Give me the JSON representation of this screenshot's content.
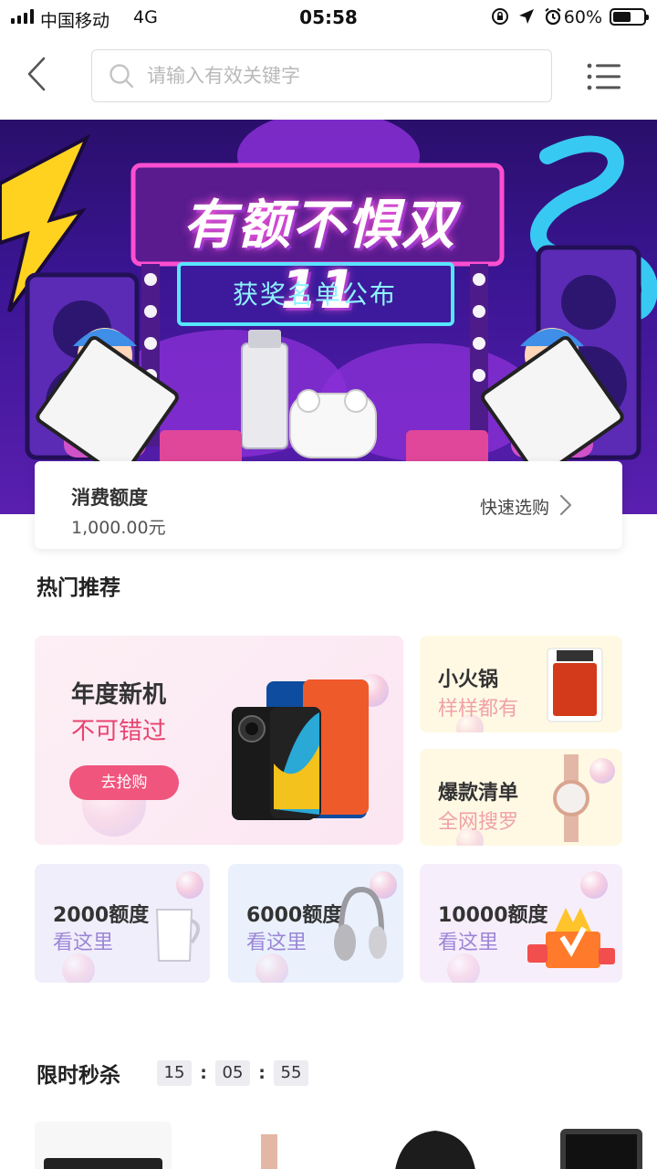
{
  "status_bar": {
    "carrier": "中国移动",
    "network": "4G",
    "time": "05:58",
    "battery_percent": "60%",
    "battery_level": 0.6
  },
  "search": {
    "placeholder": "请输入有效关键字"
  },
  "banner": {
    "title": "有额不惧双11",
    "subtitle": "获奖名单公布"
  },
  "credit": {
    "label": "消费额度",
    "amount": "1,000.00元",
    "quick_buy": "快速选购"
  },
  "hot": {
    "title": "热门推荐",
    "feature": {
      "title": "年度新机",
      "subtitle": "不可错过",
      "button": "去抢购"
    },
    "hotpot": {
      "title": "小火锅",
      "subtitle": "样样都有"
    },
    "bestseller": {
      "title": "爆款清单",
      "subtitle": "全网搜罗"
    },
    "quotas": [
      {
        "title": "2000额度",
        "subtitle": "看这里"
      },
      {
        "title": "6000额度",
        "subtitle": "看这里"
      },
      {
        "title": "10000额度",
        "subtitle": "看这里"
      }
    ]
  },
  "flash_sale": {
    "title": "限时秒杀",
    "hours": "15",
    "minutes": "05",
    "seconds": "55",
    "separator": ":"
  },
  "colors": {
    "accent_pink": "#f0557e",
    "banner_purple": "#3a1593"
  },
  "icons": {
    "back": "chevron-left-icon",
    "search": "search-icon",
    "menu": "list-menu-icon",
    "chevron": "chevron-right-icon"
  }
}
